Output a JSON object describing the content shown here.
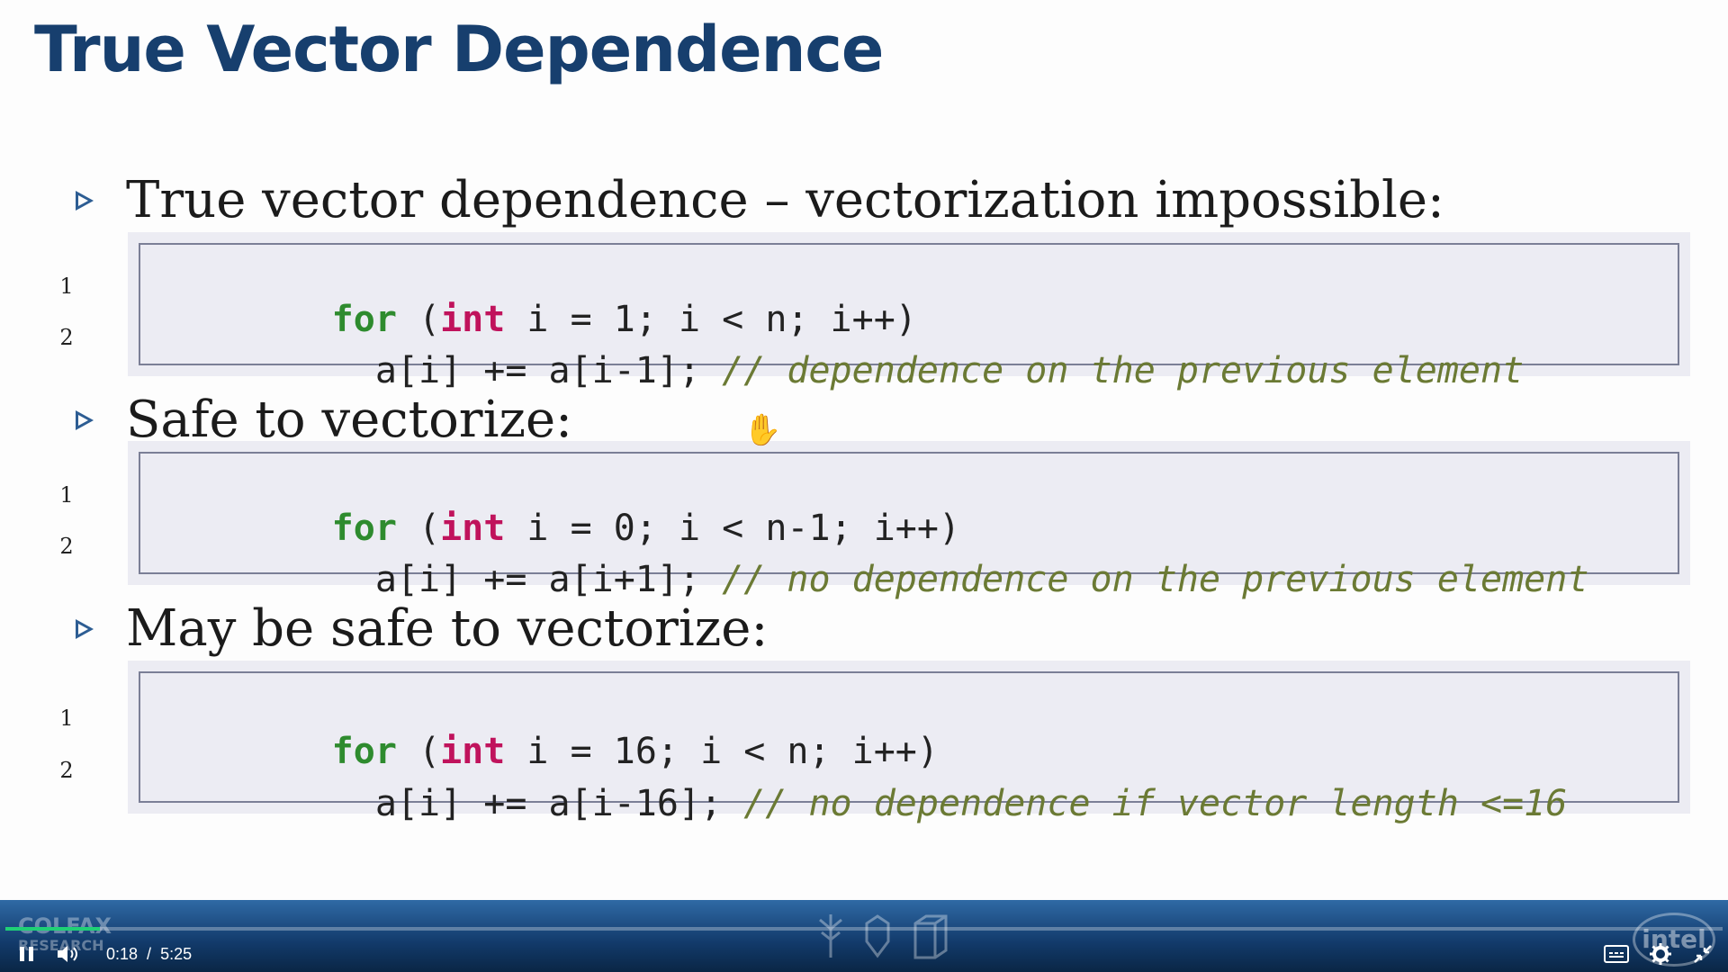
{
  "slide": {
    "title": "True Vector Dependence",
    "sections": [
      {
        "heading": "True vector dependence – vectorization impossible:",
        "lines": [
          {
            "num": "1",
            "kw": "for",
            "p1": " (",
            "type": "int",
            "rest": " i = 1; i < n; i++)",
            "comment": ""
          },
          {
            "num": "2",
            "kw": "",
            "p1": "",
            "type": "",
            "rest": "  a[i] += a[i-1]; ",
            "comment": "// dependence on the previous element"
          }
        ]
      },
      {
        "heading": "Safe to vectorize:",
        "lines": [
          {
            "num": "1",
            "kw": "for",
            "p1": " (",
            "type": "int",
            "rest": " i = 0; i < n-1; i++)",
            "comment": ""
          },
          {
            "num": "2",
            "kw": "",
            "p1": "",
            "type": "",
            "rest": "  a[i] += a[i+1]; ",
            "comment": "// no dependence on the previous element"
          }
        ]
      },
      {
        "heading": "May be safe to vectorize:",
        "lines": [
          {
            "num": "1",
            "kw": "for",
            "p1": " (",
            "type": "int",
            "rest": " i = 16; i < n; i++)",
            "comment": ""
          },
          {
            "num": "2",
            "kw": "",
            "p1": "",
            "type": "",
            "rest": "  a[i] += a[i-16]; ",
            "comment": "// no dependence if vector length <=16"
          }
        ]
      }
    ]
  },
  "player": {
    "current_time": "0:18",
    "separator": "/",
    "duration": "5:25",
    "progress_fraction": 0.055,
    "logo_left": "COLFAX",
    "logo_left_sub": "RESEARCH",
    "logo_right": "intel",
    "accent_color": "#1fd076"
  },
  "icons": {
    "play_pause": "pause-icon",
    "volume": "volume-icon",
    "captions": "captions-icon",
    "settings": "gear-icon",
    "fullscreen": "exit-fullscreen-icon",
    "cursor": "hand-cursor-icon"
  }
}
